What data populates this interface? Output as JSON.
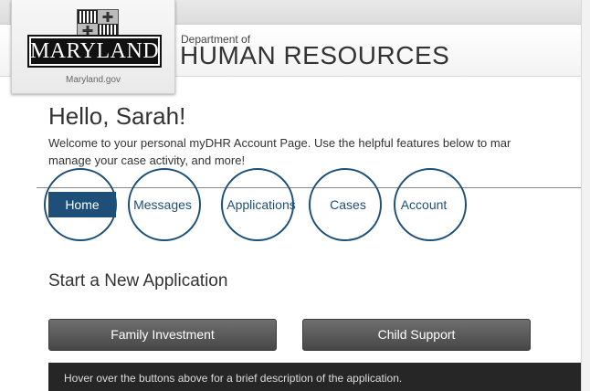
{
  "site": {
    "state_name": "MARYLAND",
    "state_url": "Maryland.gov",
    "dept_prefix": "Department of",
    "dept_name": "HUMAN RESOURCES"
  },
  "greeting": {
    "title": "Hello, Sarah!",
    "welcome_line1": "Welcome to your personal myDHR Account Page. Use the helpful features below to mar",
    "welcome_line2": "manage your case activity, and more!"
  },
  "tabs": [
    {
      "label": "Home",
      "active": true
    },
    {
      "label": "Messages",
      "active": false
    },
    {
      "label": "Applications",
      "active": false
    },
    {
      "label": "Cases",
      "active": false
    },
    {
      "label": "Account",
      "active": false
    }
  ],
  "applications": {
    "section_title": "Start a New Application",
    "buttons": [
      {
        "label": "Family Investment"
      },
      {
        "label": "Child Support"
      }
    ],
    "hint": "Hover over the buttons above for a brief description of the application."
  },
  "colors": {
    "accent": "#1d4f78",
    "button_dark": "#474747",
    "hint_bar": "#262626"
  }
}
